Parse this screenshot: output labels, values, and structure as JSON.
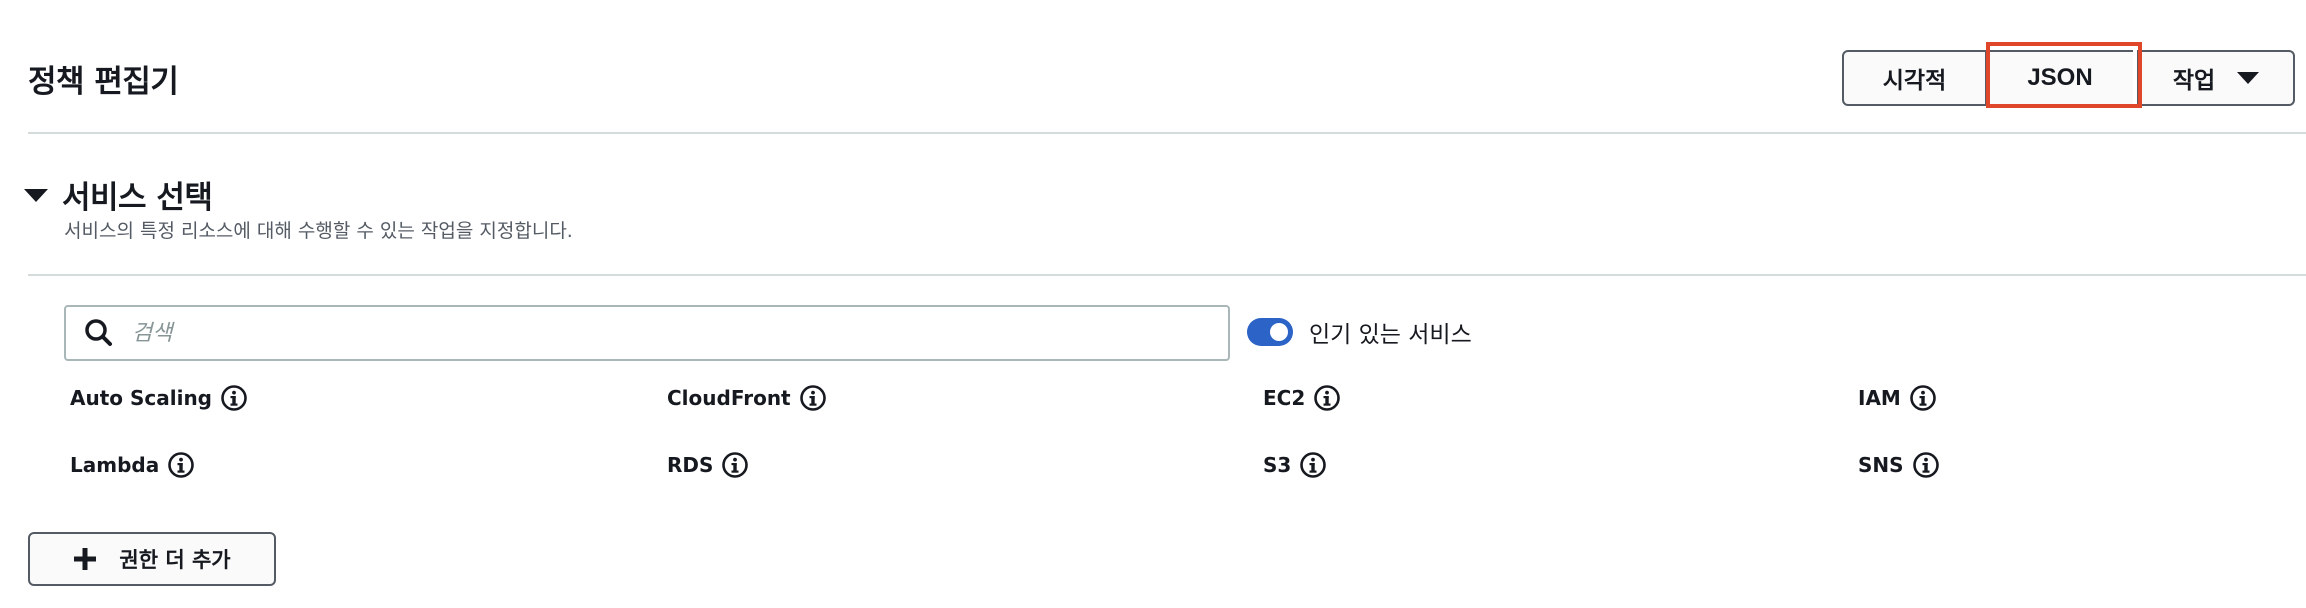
{
  "header": {
    "title": "정책 편집기",
    "view_buttons": {
      "visual": "시각적",
      "json": "JSON",
      "actions": "작업"
    },
    "highlight_color": "#e0462a"
  },
  "section": {
    "title": "서비스 선택",
    "description": "서비스의 특정 리소스에 대해 수행할 수 있는 작업을 지정합니다.",
    "expanded": true
  },
  "search": {
    "placeholder": "검색",
    "value": ""
  },
  "popular_toggle": {
    "label": "인기 있는 서비스",
    "on": true,
    "color": "#2b63c6"
  },
  "services": [
    {
      "name": "Auto Scaling"
    },
    {
      "name": "CloudFront"
    },
    {
      "name": "EC2"
    },
    {
      "name": "IAM"
    },
    {
      "name": "Lambda"
    },
    {
      "name": "RDS"
    },
    {
      "name": "S3"
    },
    {
      "name": "SNS"
    }
  ],
  "add_button": {
    "label": "권한 더 추가"
  },
  "icons": {
    "search": "search-icon",
    "info": "info-icon",
    "plus": "plus-icon",
    "caret": "caret-down-icon",
    "section_toggle": "triangle-down-icon"
  }
}
